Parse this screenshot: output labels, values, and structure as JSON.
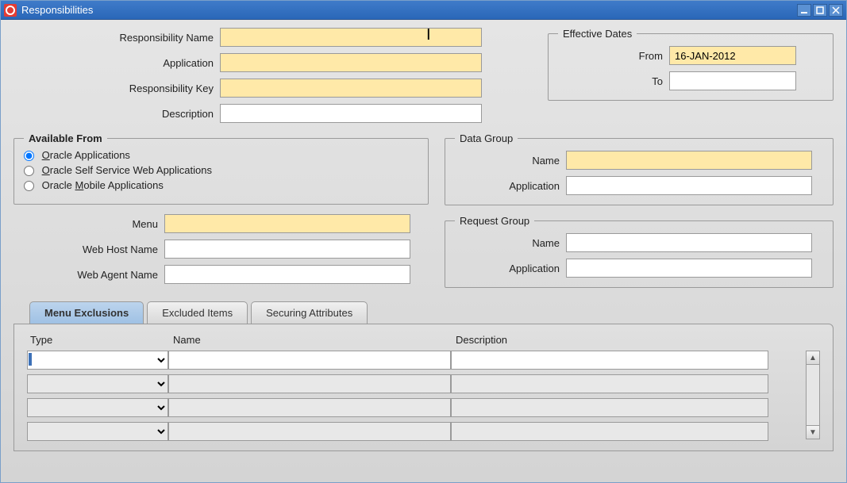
{
  "window": {
    "title": "Responsibilities"
  },
  "fields": {
    "responsibility_name_label": "Responsibility Name",
    "responsibility_name_value": "",
    "application_label": "Application",
    "application_value": "",
    "responsibility_key_label": "Responsibility Key",
    "responsibility_key_value": "",
    "description_label": "Description",
    "description_value": "",
    "menu_label": "Menu",
    "menu_value": "",
    "web_host_name_label": "Web Host Name",
    "web_host_name_value": "",
    "web_agent_name_label": "Web Agent Name",
    "web_agent_name_value": ""
  },
  "effective_dates": {
    "legend": "Effective Dates",
    "from_label": "From",
    "from_value": "16-JAN-2012",
    "to_label": "To",
    "to_value": ""
  },
  "available_from": {
    "legend": "Available From",
    "oracle_apps_prefix": "O",
    "oracle_apps_rest": "racle Applications",
    "oracle_self_prefix": "O",
    "oracle_self_rest": "racle Self Service Web Applications",
    "oracle_mobile_prefix": "Oracle ",
    "oracle_mobile_key": "M",
    "oracle_mobile_rest": "obile Applications"
  },
  "data_group": {
    "legend": "Data Group",
    "name_label": "Name",
    "name_value": "",
    "application_label": "Application",
    "application_value": ""
  },
  "request_group": {
    "legend": "Request Group",
    "name_label": "Name",
    "name_value": "",
    "application_label": "Application",
    "application_value": ""
  },
  "tabs": {
    "menu_exclusions": "Menu Exclusions",
    "excluded_items": "Excluded Items",
    "securing_attributes": "Securing Attributes"
  },
  "grid": {
    "type_header": "Type",
    "name_header": "Name",
    "description_header": "Description",
    "rows": [
      {
        "type": "",
        "name": "",
        "description": ""
      },
      {
        "type": "",
        "name": "",
        "description": ""
      },
      {
        "type": "",
        "name": "",
        "description": ""
      },
      {
        "type": "",
        "name": "",
        "description": ""
      }
    ]
  },
  "colors": {
    "required_bg": "#ffe9a8",
    "titlebar_start": "#3f7bc9",
    "titlebar_end": "#2a67b8"
  }
}
